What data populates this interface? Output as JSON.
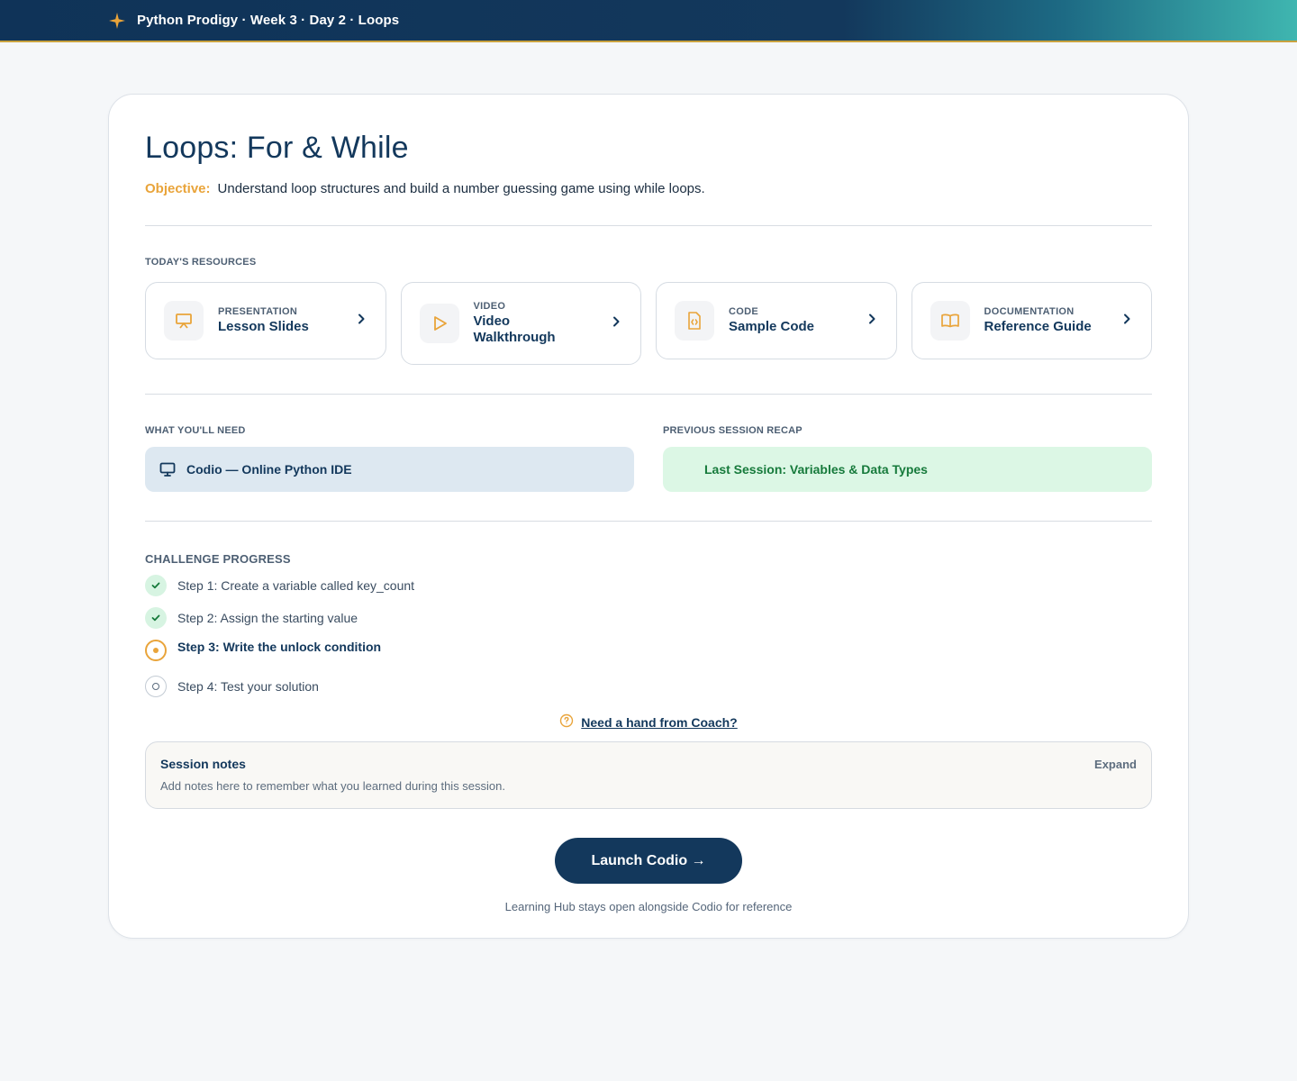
{
  "header": {
    "title": "Python Prodigy · Week 3 · Day 2 · Loops",
    "icon": "sparkle-icon",
    "accent": "#e9a43a"
  },
  "lesson": {
    "title": "Loops: For & While",
    "objective_label": "Objective:",
    "objective_text": "Understand loop structures and build a number guessing game using while loops."
  },
  "resources": {
    "label": "TODAY'S RESOURCES",
    "items": [
      {
        "kind": "PRESENTATION",
        "name": "Lesson Slides",
        "icon": "presentation-icon"
      },
      {
        "kind": "VIDEO",
        "name": "Video Walkthrough",
        "icon": "play-icon"
      },
      {
        "kind": "CODE",
        "name": "Sample Code",
        "icon": "code-file-icon"
      },
      {
        "kind": "DOCUMENTATION",
        "name": "Reference Guide",
        "icon": "book-icon"
      }
    ]
  },
  "needs": {
    "label": "WHAT YOU'LL NEED",
    "tool": "Codio — Online Python IDE"
  },
  "recap": {
    "label": "PREVIOUS SESSION RECAP",
    "text": "Last Session: Variables & Data Types"
  },
  "progress": {
    "label": "CHALLENGE PROGRESS",
    "steps": [
      {
        "text": "Step 1: Create a variable called key_count",
        "status": "done"
      },
      {
        "text": "Step 2: Assign the starting value",
        "status": "done"
      },
      {
        "text": "Step 3: Write the unlock condition",
        "status": "current"
      },
      {
        "text": "Step 4: Test your solution",
        "status": "todo"
      }
    ]
  },
  "coach": {
    "link": "Need a hand from Coach?"
  },
  "notes": {
    "title": "Session notes",
    "placeholder": "Add notes here to remember what you learned during this session.",
    "expand": "Expand"
  },
  "launch": {
    "label": "Launch Codio →",
    "hint": "Learning Hub stays open alongside Codio for reference"
  }
}
